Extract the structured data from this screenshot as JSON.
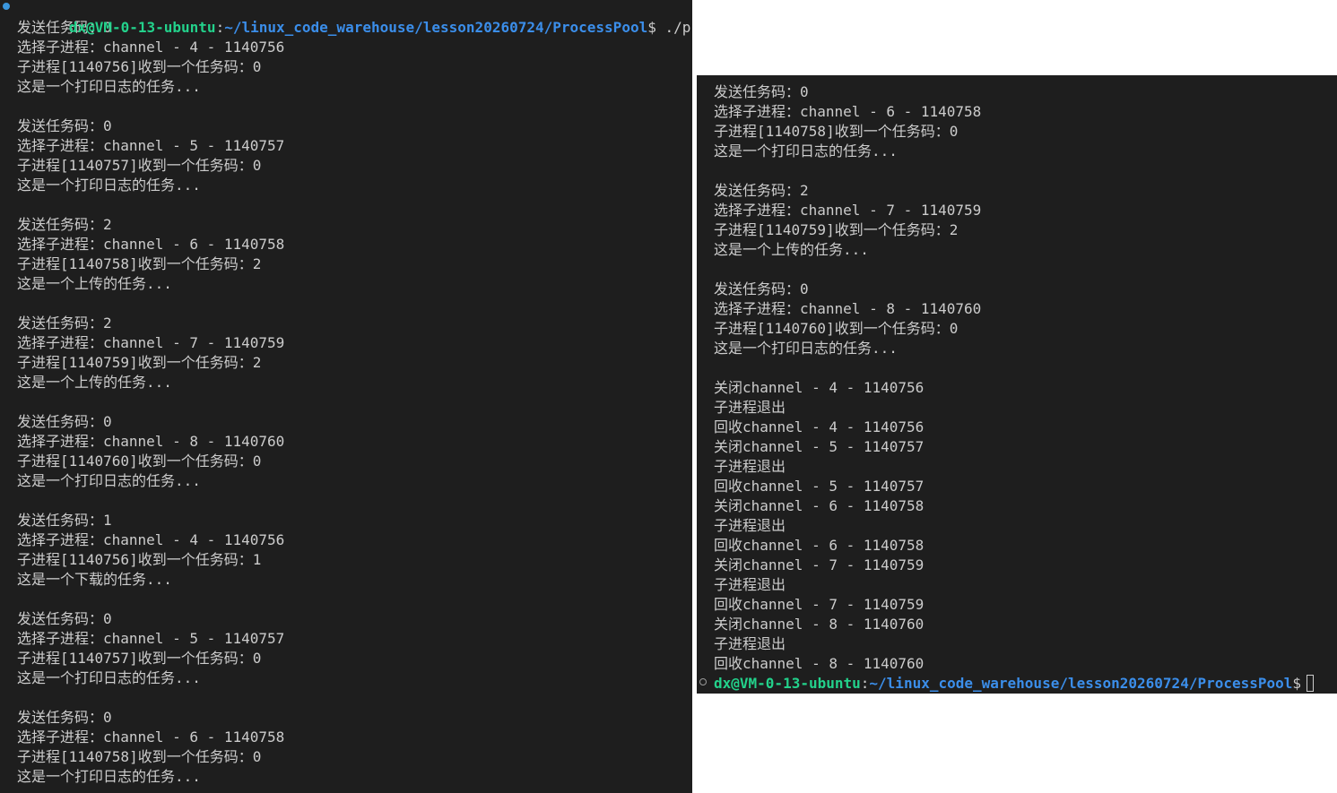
{
  "left_terminal": {
    "prompt": {
      "user_host": "dx@VM-0-13-ubuntu",
      "sep": ":",
      "path": "~/linux_code_warehouse/lesson20260724/ProcessPool",
      "symbol": "$",
      "command": " ./process_pool"
    },
    "lines": [
      "发送任务码：0",
      "选择子进程：channel - 4 - 1140756",
      "子进程[1140756]收到一个任务码：0",
      "这是一个打印日志的任务...",
      "",
      "发送任务码：0",
      "选择子进程：channel - 5 - 1140757",
      "子进程[1140757]收到一个任务码：0",
      "这是一个打印日志的任务...",
      "",
      "发送任务码：2",
      "选择子进程：channel - 6 - 1140758",
      "子进程[1140758]收到一个任务码：2",
      "这是一个上传的任务...",
      "",
      "发送任务码：2",
      "选择子进程：channel - 7 - 1140759",
      "子进程[1140759]收到一个任务码：2",
      "这是一个上传的任务...",
      "",
      "发送任务码：0",
      "选择子进程：channel - 8 - 1140760",
      "子进程[1140760]收到一个任务码：0",
      "这是一个打印日志的任务...",
      "",
      "发送任务码：1",
      "选择子进程：channel - 4 - 1140756",
      "子进程[1140756]收到一个任务码：1",
      "这是一个下载的任务...",
      "",
      "发送任务码：0",
      "选择子进程：channel - 5 - 1140757",
      "子进程[1140757]收到一个任务码：0",
      "这是一个打印日志的任务...",
      "",
      "发送任务码：0",
      "选择子进程：channel - 6 - 1140758",
      "子进程[1140758]收到一个任务码：0",
      "这是一个打印日志的任务..."
    ]
  },
  "right_terminal": {
    "lines": [
      "发送任务码：0",
      "选择子进程：channel - 6 - 1140758",
      "子进程[1140758]收到一个任务码：0",
      "这是一个打印日志的任务...",
      "",
      "发送任务码：2",
      "选择子进程：channel - 7 - 1140759",
      "子进程[1140759]收到一个任务码：2",
      "这是一个上传的任务...",
      "",
      "发送任务码：0",
      "选择子进程：channel - 8 - 1140760",
      "子进程[1140760]收到一个任务码：0",
      "这是一个打印日志的任务...",
      "",
      "关闭channel - 4 - 1140756",
      "子进程退出",
      "回收channel - 4 - 1140756",
      "关闭channel - 5 - 1140757",
      "子进程退出",
      "回收channel - 5 - 1140757",
      "关闭channel - 6 - 1140758",
      "子进程退出",
      "回收channel - 6 - 1140758",
      "关闭channel - 7 - 1140759",
      "子进程退出",
      "回收channel - 7 - 1140759",
      "关闭channel - 8 - 1140760",
      "子进程退出",
      "回收channel - 8 - 1140760"
    ],
    "prompt": {
      "user_host": "dx@VM-0-13-ubuntu",
      "sep": ":",
      "path": "~/linux_code_warehouse/lesson20260724/ProcessPool",
      "symbol": "$"
    }
  },
  "colors": {
    "terminal_bg": "#1e1e1e",
    "text": "#cccccc",
    "user_host": "#23d18b",
    "path": "#3b8eea",
    "dot_active": "#3a96dd"
  }
}
